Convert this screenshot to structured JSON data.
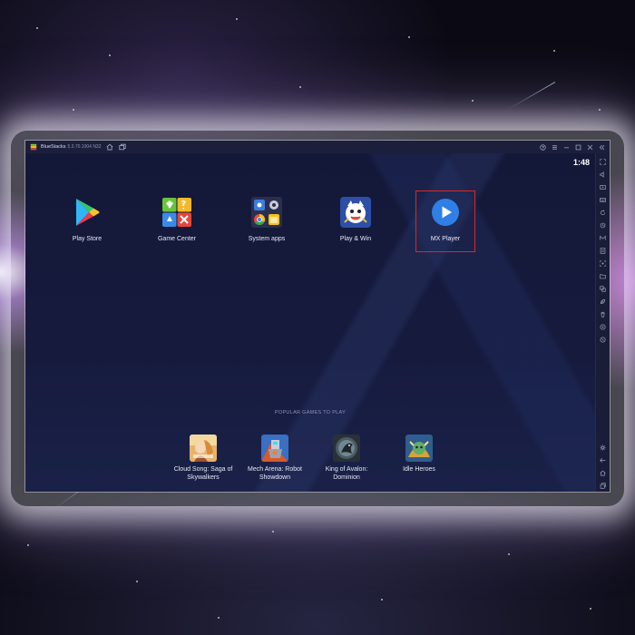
{
  "window": {
    "app_name": "BlueStacks",
    "version": "5.3.70.1004 N32",
    "title_icons": [
      "home-icon",
      "multi-instance-icon"
    ],
    "controls": [
      "help-icon",
      "menu-icon",
      "minimize-icon",
      "maximize-icon",
      "close-icon",
      "collapse-sidebar-icon"
    ]
  },
  "status": {
    "time": "1:48"
  },
  "apps": [
    {
      "label": "Play Store",
      "icon": "play-store-icon"
    },
    {
      "label": "Game Center",
      "icon": "game-center-icon"
    },
    {
      "label": "System apps",
      "icon": "system-apps-icon"
    },
    {
      "label": "Play & Win",
      "icon": "play-and-win-icon"
    },
    {
      "label": "MX Player",
      "icon": "mx-player-icon",
      "highlighted": true
    }
  ],
  "popular": {
    "heading": "POPULAR GAMES TO PLAY",
    "games": [
      {
        "line1": "Cloud Song: Saga of",
        "line2": "Skywalkers"
      },
      {
        "line1": "Mech Arena: Robot",
        "line2": "Showdown"
      },
      {
        "line1": "King of Avalon:",
        "line2": "Dominion"
      },
      {
        "line1": "Idle Heroes",
        "line2": ""
      }
    ]
  },
  "sidebar_tools": [
    "fullscreen-icon",
    "volume-icon",
    "media-icon",
    "keyboard-icon",
    "rotate-icon",
    "sync-icon",
    "macro-icon",
    "apk-install-icon",
    "screenshot-icon",
    "folder-icon",
    "multi-instance-manager-icon",
    "eco-mode-icon",
    "trash-icon",
    "location-icon",
    "shake-icon",
    "settings-icon",
    "back-icon",
    "home-icon",
    "recent-apps-icon"
  ],
  "colors": {
    "screen_bg": "#16193a",
    "highlight_border": "#e0261f",
    "mx_player_blue": "#2f7fe6"
  }
}
